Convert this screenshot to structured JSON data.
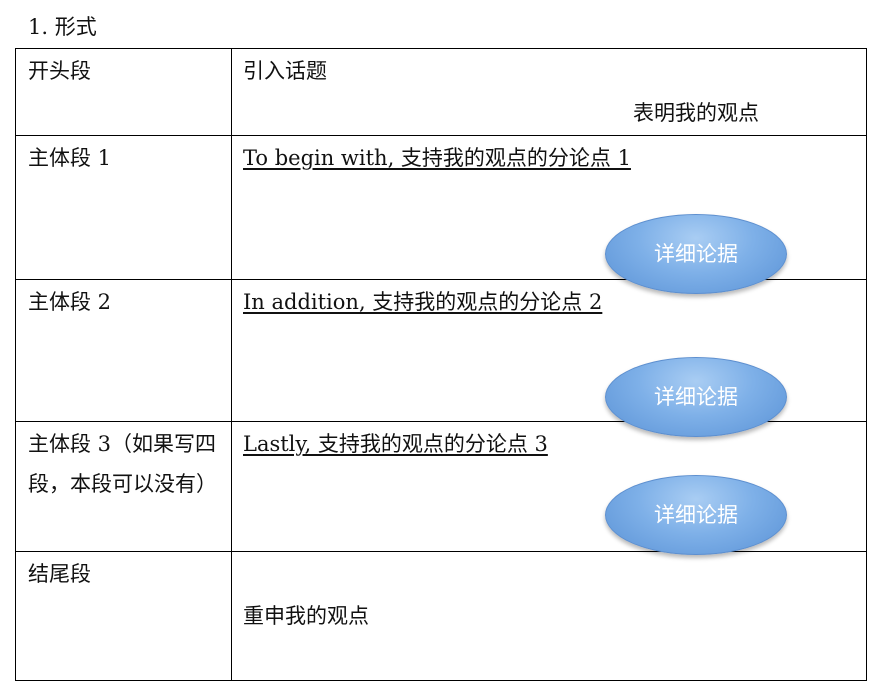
{
  "heading": "1.  形式",
  "rows": [
    {
      "label": "开头段",
      "lines": [
        "引入话题",
        "表明我的观点"
      ]
    },
    {
      "label": "主体段 1",
      "point": "To begin with,  支持我的观点的分论点 1 ",
      "bubble": "详细论据"
    },
    {
      "label": "主体段 2",
      "point": "In addition,  支持我的观点的分论点 2",
      "bubble": "详细论据"
    },
    {
      "label": "主体段  3（如果写四段，本段可以没有）",
      "point": "Lastly,  支持我的观点的分论点 3",
      "bubble": "详细论据"
    },
    {
      "label": "结尾段",
      "lines": [
        "重申我的观点"
      ]
    }
  ],
  "colors": {
    "bubble_fill": "#7eb0e8",
    "bubble_text": "#ffffff",
    "border": "#000000"
  }
}
